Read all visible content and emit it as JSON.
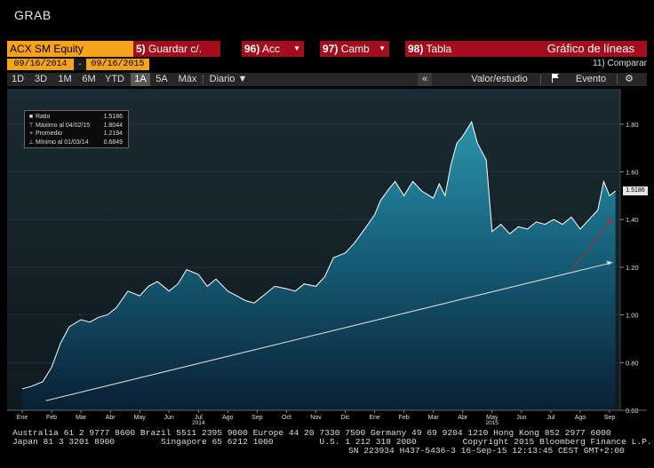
{
  "window": {
    "title": "GRAB"
  },
  "toolbar": {
    "ticker": "ACX SM Equity",
    "buttons": [
      {
        "num": "5)",
        "label": "Guardar c/.",
        "dropdown": false
      },
      {
        "num": "96)",
        "label": "Acc",
        "dropdown": true
      },
      {
        "num": "97)",
        "label": "Camb",
        "dropdown": true
      },
      {
        "num": "98)",
        "label": "Tabla",
        "dropdown": false
      },
      {
        "num": "",
        "label": "Gráfico de líneas",
        "dropdown": false
      }
    ],
    "start_date": "09/16/2014",
    "date_sep": "-",
    "end_date": "09/16/2015",
    "compare": "11) Comparar",
    "ranges": [
      "1D",
      "3D",
      "1M",
      "6M",
      "YTD",
      "1A",
      "5A",
      "Máx"
    ],
    "active_range": "1A",
    "frequency": "Diario ▼",
    "collapse": "«",
    "value_study": "Valor/estudio",
    "event_icon": "flag-icon",
    "event": "Evento",
    "settings_icon": "gear-icon"
  },
  "chart_data": {
    "type": "area",
    "title": "",
    "xlabel": "",
    "ylabel": "",
    "ylim": [
      0.6,
      1.9
    ],
    "yticks": [
      "0.60",
      "0.80",
      "1.00",
      "1.20",
      "1.40",
      "1.60",
      "1.80"
    ],
    "xticks": [
      "Ene",
      "Feb",
      "Mar",
      "Abr",
      "May",
      "Jun",
      "Jul",
      "Ago",
      "Sep",
      "Oct",
      "Nov",
      "Dic",
      "Ene",
      "Feb",
      "Mar",
      "Abr",
      "May",
      "Jun",
      "Jul",
      "Ago",
      "Sep"
    ],
    "year_labels": [
      {
        "label": "2014",
        "month_index": 6
      },
      {
        "label": "2015",
        "month_index": 16
      }
    ],
    "last_value": "1.5186",
    "series": [
      {
        "x": [
          0,
          0.3,
          0.7,
          1.0,
          1.3,
          1.6,
          2.0,
          2.3,
          2.6,
          2.9,
          3.2,
          3.6,
          4.0,
          4.3,
          4.6,
          5.0,
          5.3,
          5.6,
          6.0,
          6.3,
          6.6,
          7.0,
          7.3,
          7.6,
          7.9,
          8.3,
          8.6,
          9.0,
          9.3,
          9.6,
          10.0,
          10.3,
          10.6,
          11.0,
          11.3,
          11.6,
          12.0,
          12.2,
          12.5,
          12.7,
          13.0,
          13.3,
          13.6,
          14.0,
          14.2,
          14.4,
          14.6,
          14.8,
          15.0,
          15.3,
          15.5,
          15.8,
          16.0,
          16.3,
          16.6,
          16.9,
          17.2,
          17.5,
          17.8,
          18.1,
          18.4,
          18.7,
          19.0,
          19.3,
          19.6,
          19.8,
          20.0,
          20.2
        ],
        "values": [
          0.69,
          0.7,
          0.72,
          0.78,
          0.88,
          0.95,
          0.98,
          0.97,
          0.99,
          1.0,
          1.03,
          1.1,
          1.08,
          1.12,
          1.14,
          1.1,
          1.13,
          1.19,
          1.17,
          1.12,
          1.15,
          1.1,
          1.08,
          1.06,
          1.05,
          1.09,
          1.12,
          1.11,
          1.1,
          1.13,
          1.12,
          1.16,
          1.24,
          1.26,
          1.3,
          1.35,
          1.42,
          1.48,
          1.53,
          1.56,
          1.5,
          1.56,
          1.52,
          1.49,
          1.55,
          1.5,
          1.63,
          1.72,
          1.75,
          1.81,
          1.72,
          1.65,
          1.35,
          1.38,
          1.34,
          1.37,
          1.36,
          1.39,
          1.38,
          1.4,
          1.38,
          1.41,
          1.36,
          1.4,
          1.44,
          1.56,
          1.5,
          1.52
        ]
      }
    ],
    "trendlines": [
      {
        "color": "#dcdcdc",
        "from": [
          0.8,
          0.64
        ],
        "to": [
          20.1,
          1.22
        ]
      },
      {
        "color": "#c0262c",
        "from": [
          18.7,
          1.19
        ],
        "to": [
          20.1,
          1.4
        ]
      }
    ],
    "legend": {
      "placement": "top-left",
      "rows": [
        {
          "marker": "■",
          "label": "Ratio",
          "value": "1.5186"
        },
        {
          "marker": "⊤",
          "label": "Máximo al 04/02/15",
          "value": "1.8044"
        },
        {
          "marker": "+",
          "label": "Promedio",
          "value": "1.2194"
        },
        {
          "marker": "⊥",
          "label": "Mínimo al 01/03/14",
          "value": "0.6849"
        }
      ]
    }
  },
  "footer": {
    "line1": "Australia 61 2 9777 8600 Brazil 5511 2395 9000 Europe 44 20 7330 7500 Germany 49 69 9204 1210 Hong Kong 852 2977 6000",
    "line2": "Japan 81 3 3201 8900         Singapore 65 6212 1000         U.S. 1 212 318 2000         Copyright 2015 Bloomberg Finance L.P.",
    "line3": "SN 223934 H437-5436-3 16-Sep-15 12:13:45 CEST GMT+2:00"
  }
}
